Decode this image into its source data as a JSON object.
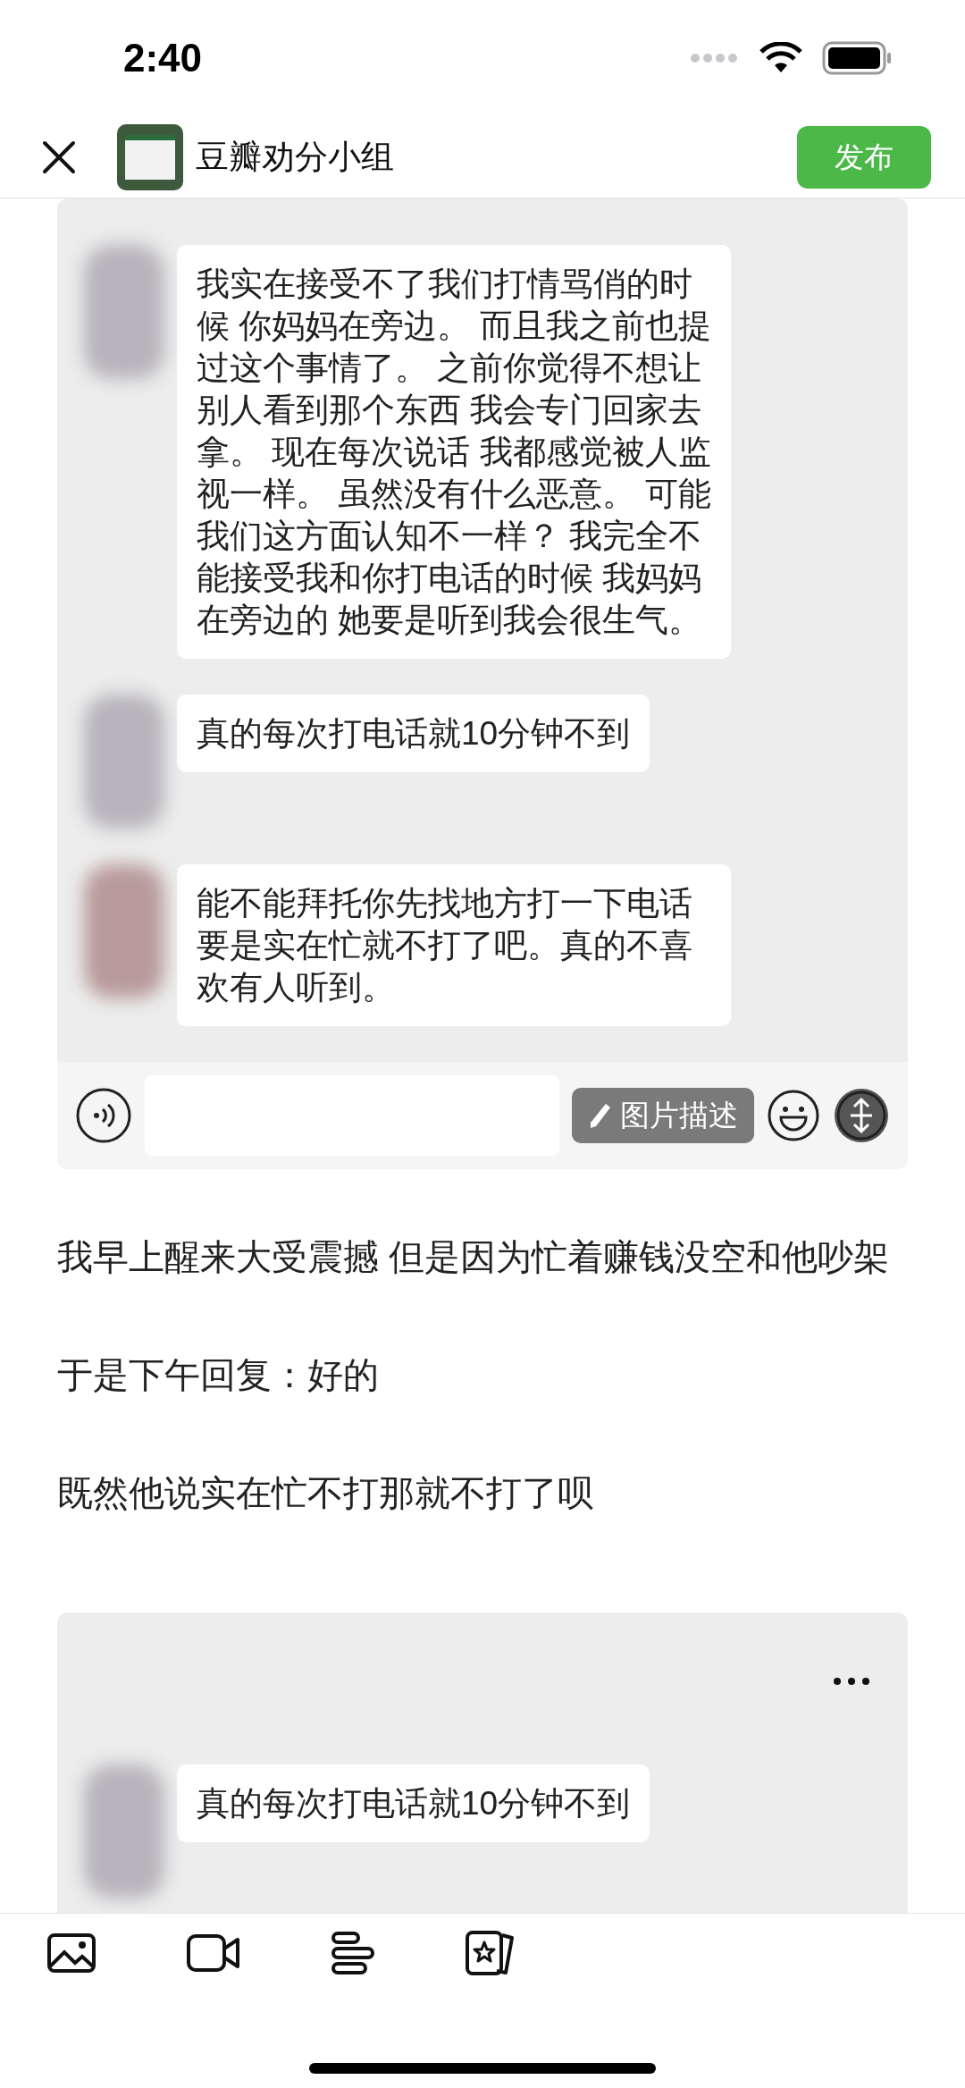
{
  "status_bar": {
    "time": "2:40"
  },
  "header": {
    "group_name": "豆瓣劝分小组",
    "publish_button": "发布"
  },
  "content": [
    {
      "kind": "chat_with_input",
      "messages": [
        "我实在接受不了我们打情骂俏的时候 你妈妈在旁边。 而且我之前也提过这个事情了。 之前你觉得不想让别人看到那个东西 我会专门回家去拿。 现在每次说话 我都感觉被人监视一样。 虽然没有什么恶意。 可能我们这方面认知不一样？ 我完全不能接受我和你打电话的时候 我妈妈在旁边的 她要是听到我会很生气。",
        "真的每次打电话就10分钟不到",
        "能不能拜托你先找地方打一下电话要是实在忙就不打了吧。真的不喜欢有人听到。"
      ],
      "description_button": "图片描述"
    },
    {
      "kind": "paragraph",
      "text": "我早上醒来大受震撼 但是因为忙着赚钱没空和他吵架"
    },
    {
      "kind": "paragraph",
      "text": "于是下午回复：好的"
    },
    {
      "kind": "paragraph",
      "text": "既然他说实在忙不打那就不打了呗"
    },
    {
      "kind": "chat_with_menu",
      "messages": [
        "真的每次打电话就10分钟不到"
      ]
    }
  ]
}
